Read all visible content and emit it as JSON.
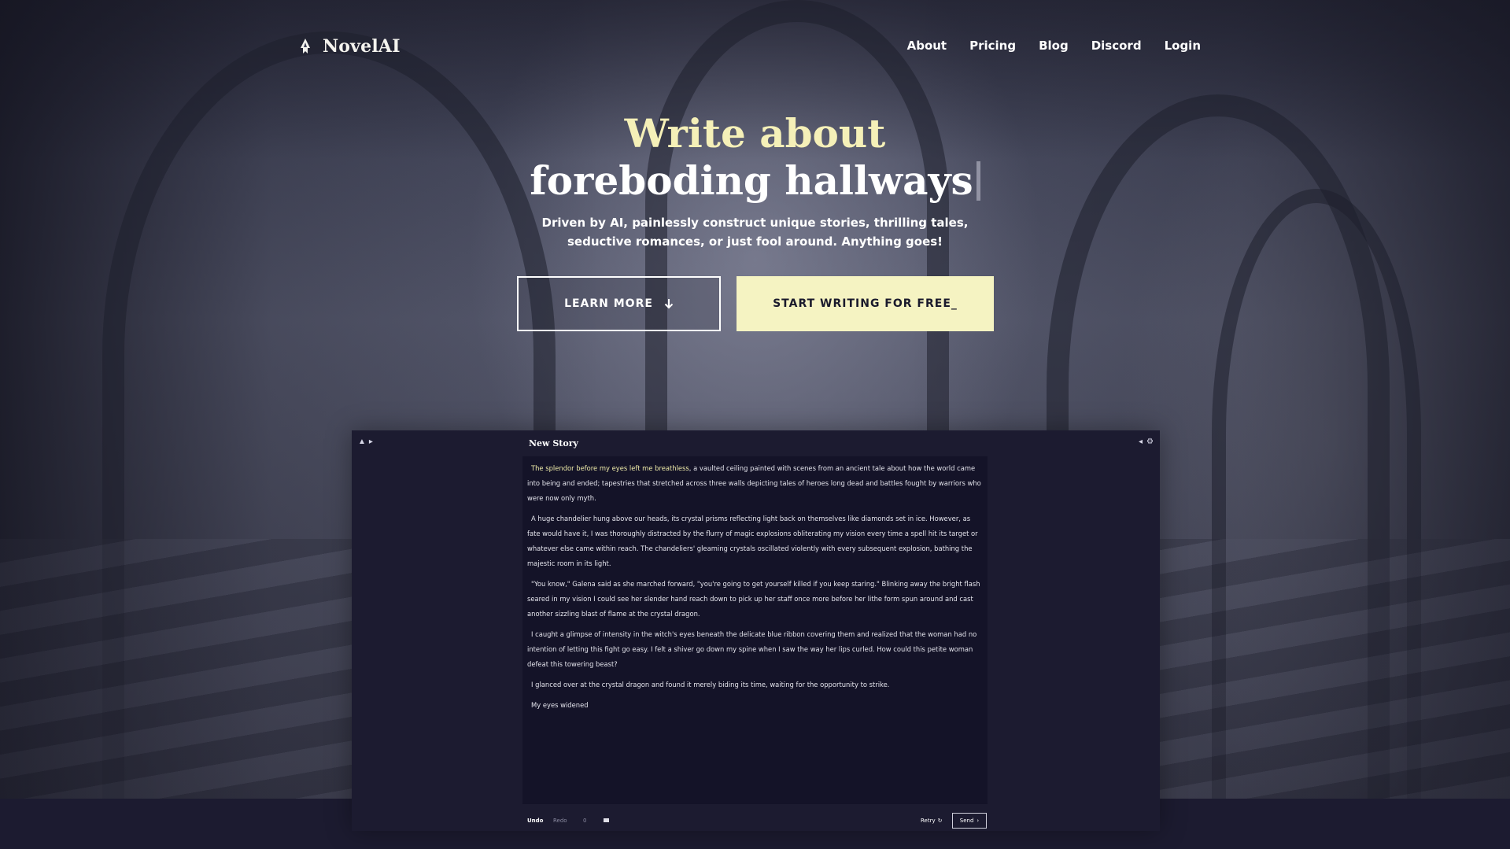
{
  "brand": {
    "name": "NovelAI",
    "icon": "novelai-pen-icon"
  },
  "nav": [
    {
      "label": "About"
    },
    {
      "label": "Pricing"
    },
    {
      "label": "Blog"
    },
    {
      "label": "Discord"
    },
    {
      "label": "Login"
    }
  ],
  "hero": {
    "headline_line1": "Write about",
    "headline_line2": "foreboding hallways",
    "subtitle_line1": "Driven by AI, painlessly construct unique stories, thrilling tales,",
    "subtitle_line2": "seductive romances, or just fool around. Anything goes!"
  },
  "buttons": {
    "learn_more": "LEARN MORE",
    "learn_more_icon": "arrow-down-icon",
    "start_writing": "START WRITING FOR FREE_"
  },
  "editor": {
    "title": "New Story",
    "paragraph1_highlight": "The splendor before my eyes left me breathless",
    "paragraph1_rest": ", a vaulted ceiling painted with scenes from an ancient tale about how the world came into being and ended; tapestries that stretched across three walls depicting tales of heroes long dead and battles fought by warriors who were now only myth.",
    "paragraph2": "A huge chandelier hung above our heads, its crystal prisms reflecting light back on themselves like diamonds set in ice. However, as fate would have it, I was thoroughly distracted by the flurry of magic explosions obliterating my vision every time a spell hit its target or whatever else came within reach. The chandeliers' gleaming crystals oscillated violently with every subsequent explosion, bathing the majestic room in its light.",
    "paragraph3": "\"You know,\" Galena said as she marched forward, \"you're going to get yourself killed if you keep staring.\" Blinking away the bright flash seared in my vision I could see her slender hand reach down to pick up her staff once more before her lithe form spun around and cast another sizzling blast of flame at the crystal dragon.",
    "paragraph4": "I caught a glimpse of intensity in the witch's eyes beneath the delicate blue ribbon covering them and realized that the woman had no intention of letting this fight go easy. I felt a shiver go down my spine when I saw the way her lips curled. How could this petite woman defeat this towering beast?",
    "paragraph5": "I glanced over at the crystal dragon and found it merely biding its time, waiting for the opportunity to strike.",
    "paragraph6": "My eyes widened",
    "footer": {
      "undo": "Undo",
      "redo": "Redo",
      "count": "0",
      "retry": "Retry",
      "send": "Send"
    }
  },
  "colors": {
    "accent": "#f5f3c2",
    "headline_accent": "#f5f0b8",
    "background_dark": "#1c1b30"
  }
}
